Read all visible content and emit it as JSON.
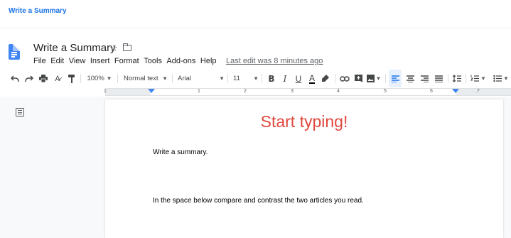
{
  "header": {
    "app_link": "Write a Summary"
  },
  "document": {
    "title": "Write a Summary",
    "menus": [
      "File",
      "Edit",
      "View",
      "Insert",
      "Format",
      "Tools",
      "Add-ons",
      "Help"
    ],
    "last_edit": "Last edit was 8 minutes ago"
  },
  "toolbar": {
    "zoom": "100%",
    "style": "Normal text",
    "font": "Arial",
    "font_size": "11",
    "bold": "B",
    "italic": "I",
    "underline": "U",
    "text_color": "A"
  },
  "ruler": {
    "numbers": [
      "1",
      "1",
      "2",
      "3",
      "4",
      "5",
      "6",
      "7"
    ]
  },
  "page": {
    "heading": "Start typing!",
    "paragraph_1": "Write a summary.",
    "paragraph_2": "In the space below compare and contrast the two articles you read."
  },
  "colors": {
    "accent": "#1a73e8",
    "heading": "#e0483e",
    "docs_blue": "#4285f4"
  },
  "icons": [
    "undo-icon",
    "redo-icon",
    "print-icon",
    "spellcheck-icon",
    "paint-format-icon",
    "highlighter-icon",
    "link-icon",
    "comment-icon",
    "image-icon",
    "align-left-icon",
    "align-center-icon",
    "align-right-icon",
    "justify-icon",
    "line-spacing-icon",
    "numbered-list-icon",
    "bulleted-list-icon",
    "star-icon",
    "folder-icon",
    "outline-icon"
  ]
}
